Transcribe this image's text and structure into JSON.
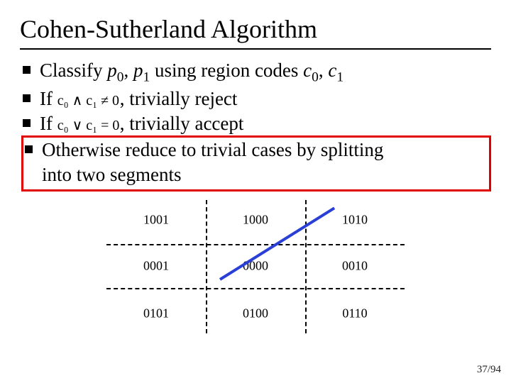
{
  "title": "Cohen-Sutherland Algorithm",
  "bullets": {
    "b0_pre": "Classify ",
    "b0_p0": "p",
    "b0_p0_sub": "0",
    "b0_mid1": ", ",
    "b0_p1": "p",
    "b0_p1_sub": "1",
    "b0_mid2": " using region codes ",
    "b0_c0": "c",
    "b0_c0_sub": "0",
    "b0_mid3": ", ",
    "b0_c1": "c",
    "b0_c1_sub": "1",
    "b1_pre": "If ",
    "b1_formula": "c₀ ∧ c₁ ≠ 0",
    "b1_post": ", trivially reject",
    "b2_pre": "If ",
    "b2_formula": "c₀ ∨ c₁ = 0",
    "b2_post": ", trivially accept",
    "b3_line1_pre": "Otherwise reduce to trivial cases by splitting",
    "b3_line2": "into two segments"
  },
  "codes": {
    "tl": "1001",
    "tc": "1000",
    "tr": "1010",
    "ml": "0001",
    "mc": "0000",
    "mr": "0010",
    "bl": "0101",
    "bc": "0100",
    "br": "0110"
  },
  "page": "37/94"
}
